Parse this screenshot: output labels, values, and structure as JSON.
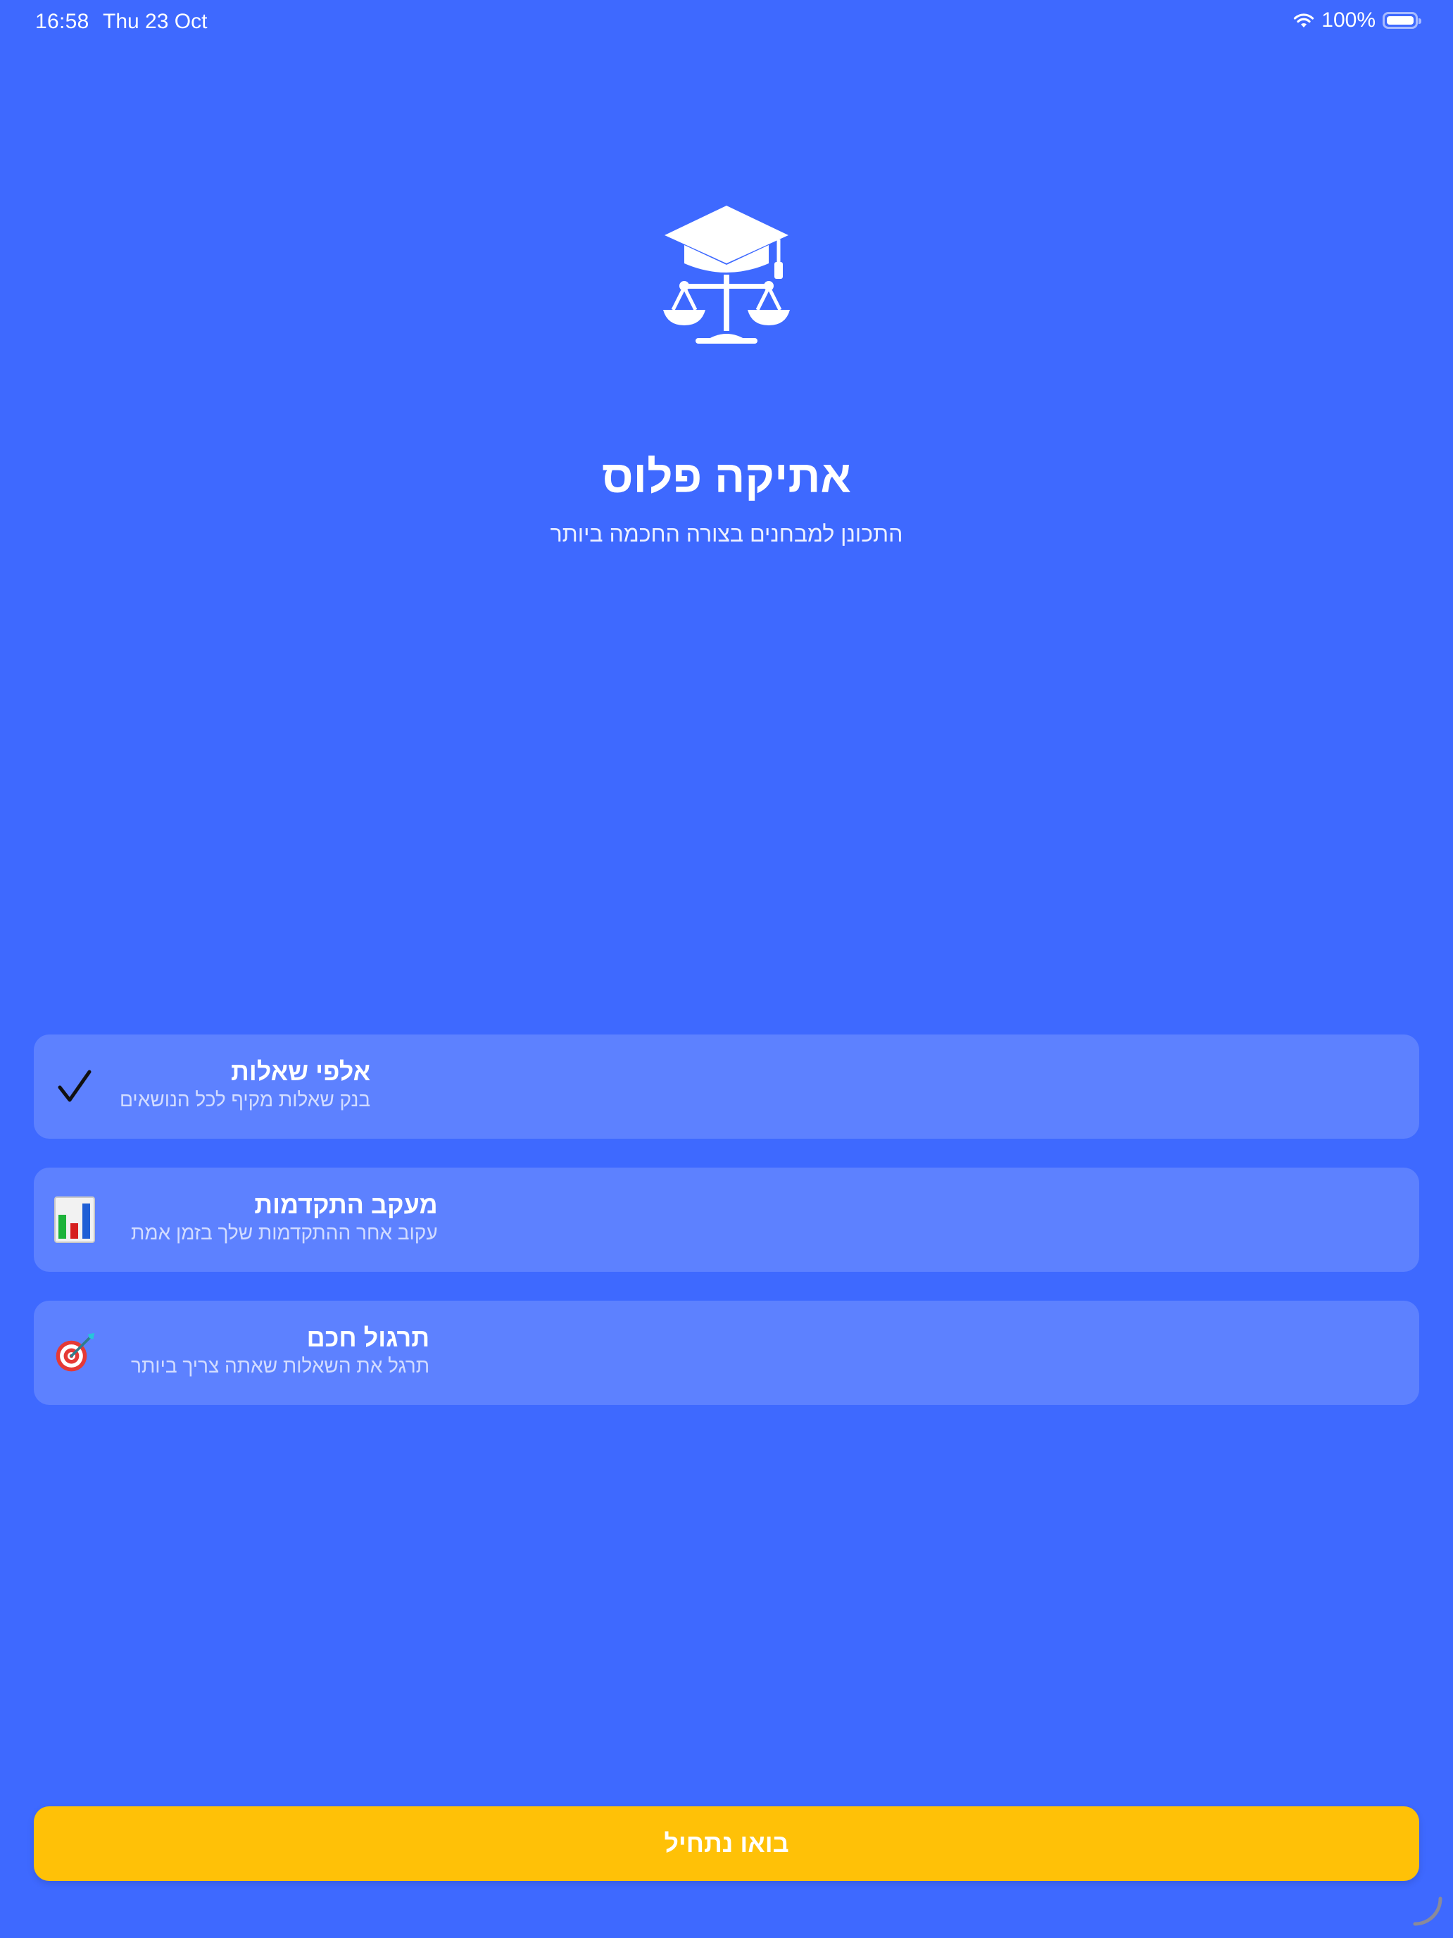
{
  "status_bar": {
    "time": "16:58",
    "date": "Thu 23 Oct",
    "battery": "100%"
  },
  "hero": {
    "logo_icon": "graduation-cap-scales-icon",
    "title": "אתיקה פלוס",
    "subtitle": "התכונן למבחנים בצורה החכמה ביותר"
  },
  "features": [
    {
      "icon": "checkmark-icon",
      "title": "אלפי שאלות",
      "description": "בנק שאלות מקיף לכל הנושאים"
    },
    {
      "icon": "bar-chart-icon",
      "title": "מעקב התקדמות",
      "description": "עקוב אחר ההתקדמות שלך בזמן אמת"
    },
    {
      "icon": "target-dart-icon",
      "title": "תרגול חכם",
      "description": "תרגל את השאלות שאתה צריך ביותר"
    }
  ],
  "cta": {
    "label": "בואו נתחיל"
  },
  "colors": {
    "background": "#3E69FF",
    "card": "#5B80FF",
    "button": "#FFC107"
  }
}
